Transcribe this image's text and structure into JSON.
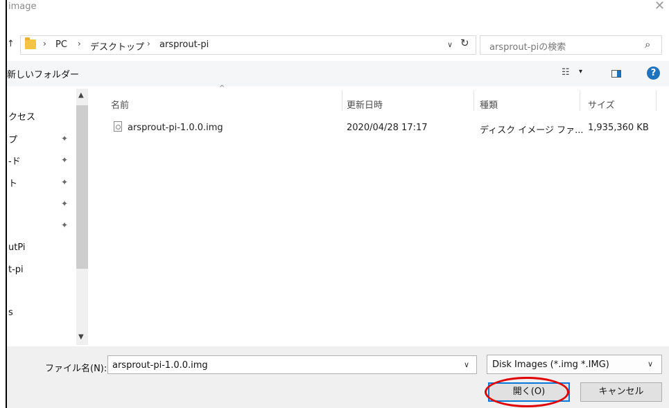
{
  "window": {
    "title": "image",
    "close_glyph": "✕"
  },
  "address": {
    "up_glyph": "↑",
    "breadcrumb": [
      "PC",
      "デスクトップ",
      "arsprout-pi"
    ],
    "sep": "›",
    "dropdown_glyph": "∨",
    "refresh_glyph": "↻"
  },
  "search": {
    "placeholder": "arsprout-piの検索",
    "icon_glyph": "⌕"
  },
  "toolbar": {
    "new_folder": "新しいフォルダー",
    "view_glyph": "☷",
    "drop_glyph": "▾",
    "help": "?"
  },
  "nav": {
    "items": [
      "クセス",
      "プ",
      "-ド",
      "ト",
      "",
      "",
      "utPi",
      "t-pi",
      "",
      "s",
      ""
    ],
    "pin_glyph": "📌"
  },
  "columns": {
    "name": "名前",
    "date": "更新日時",
    "type": "種類",
    "size": "サイズ",
    "sort_glyph": "^"
  },
  "files": [
    {
      "name": "arsprout-pi-1.0.0.img",
      "date": "2020/04/28 17:17",
      "type": "ディスク イメージ ファ...",
      "size": "1,935,360 KB"
    }
  ],
  "bottom": {
    "filename_label": "ファイル名(N):",
    "filename_value": "arsprout-pi-1.0.0.img",
    "filter_value": "Disk Images (*.img *.IMG)",
    "dropdown_glyph": "∨",
    "open_label": "開く(O)",
    "cancel_label": "キャンセル"
  },
  "colors": {
    "accent": "#0078d7",
    "highlight_circle": "#e00000",
    "folder": "#f5c342",
    "help": "#1e73be"
  }
}
